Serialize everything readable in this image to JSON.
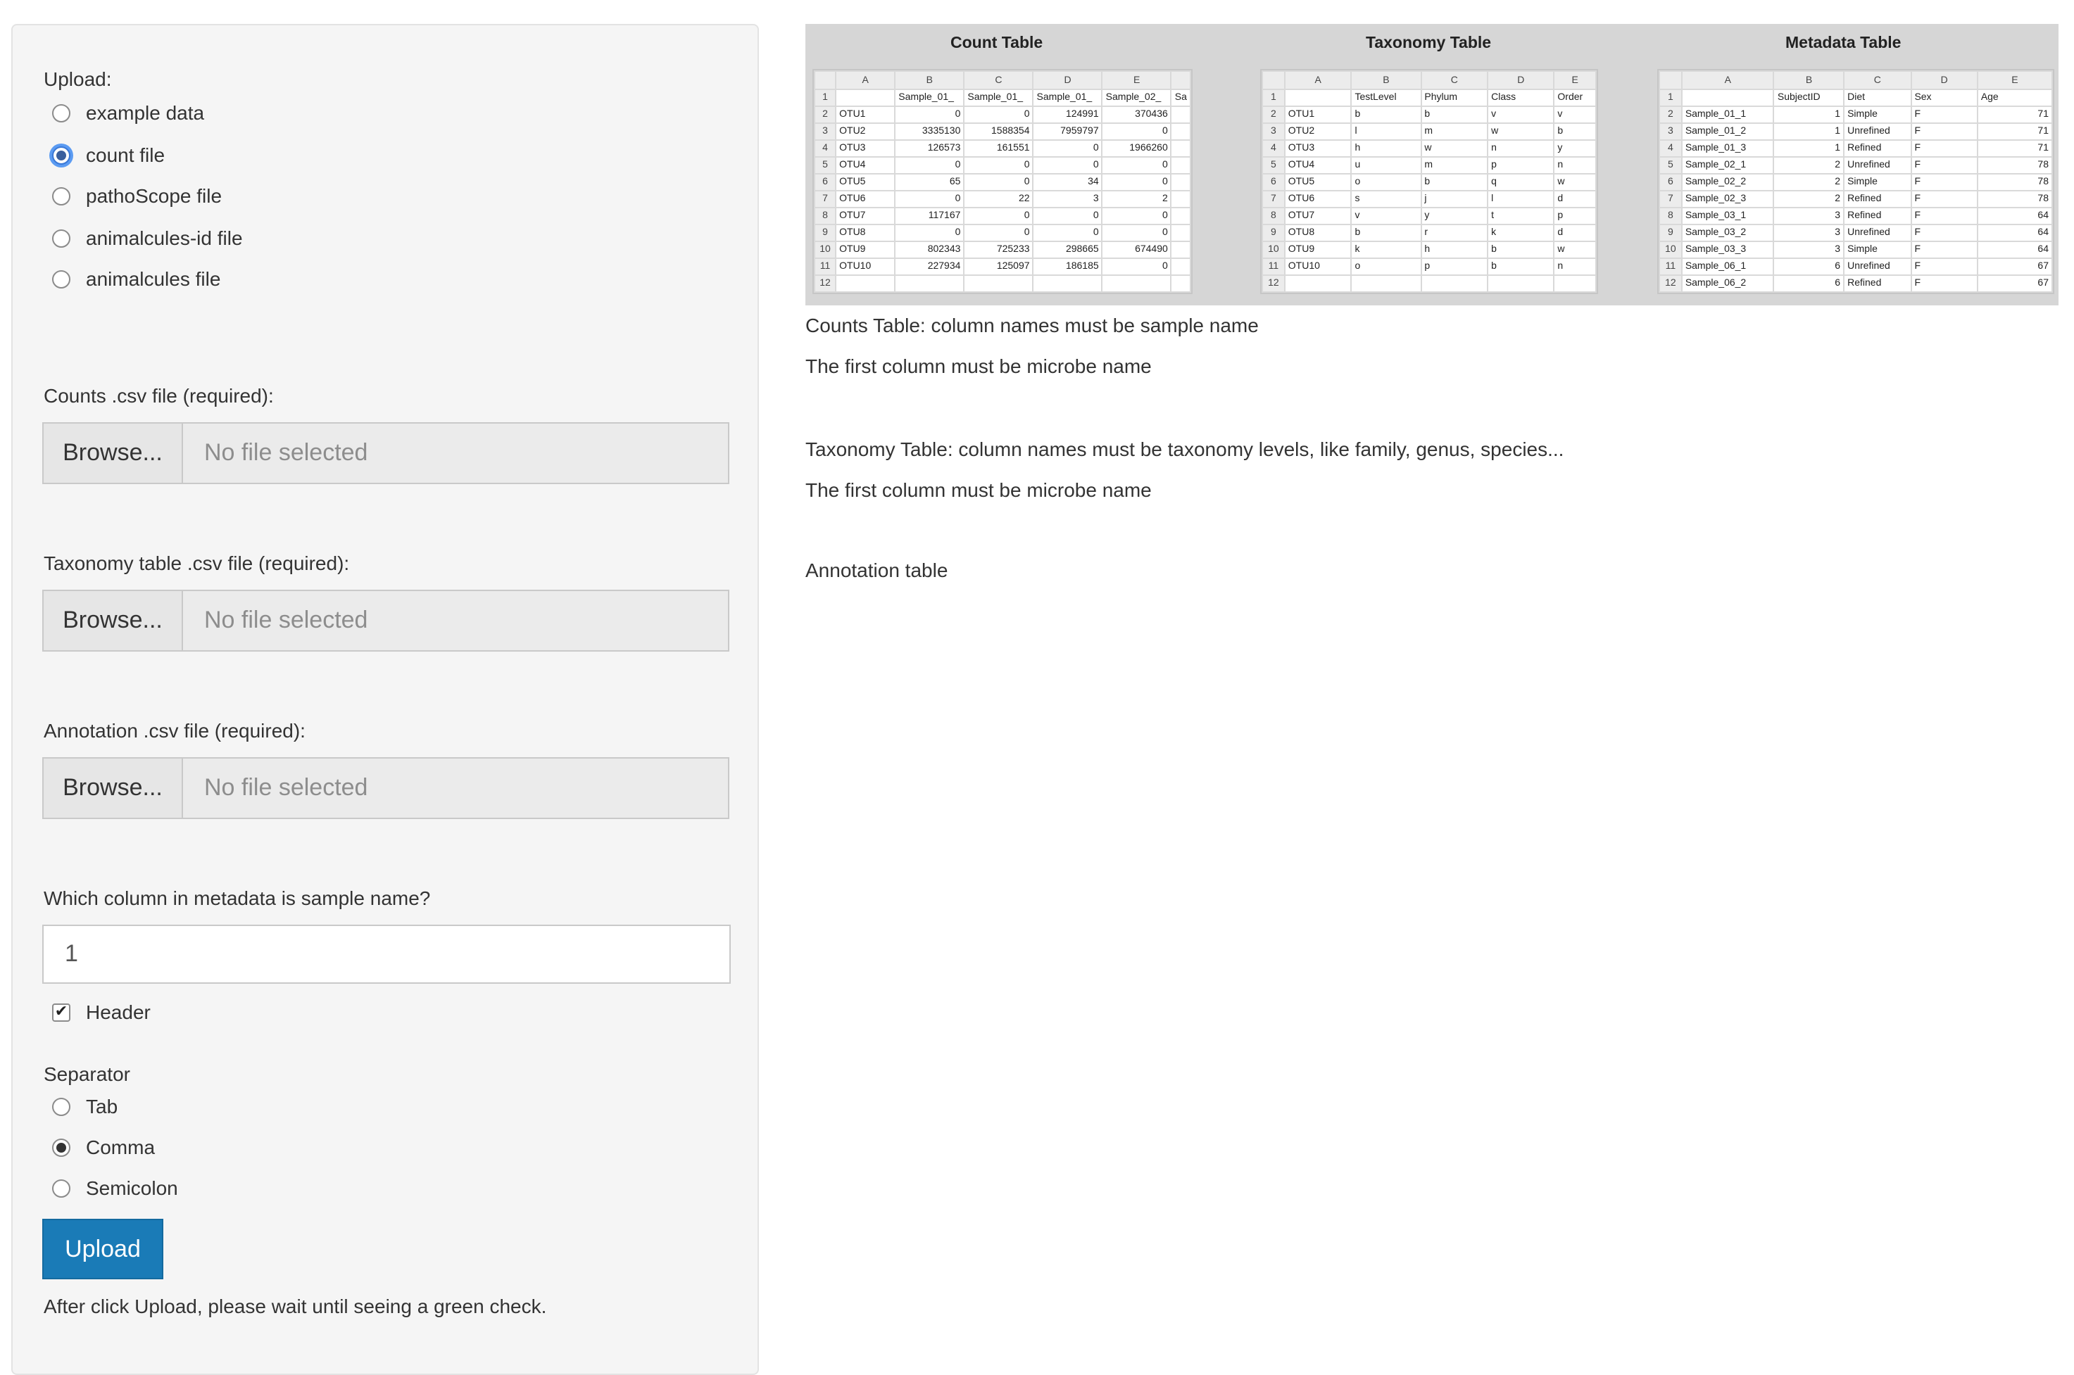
{
  "upload": {
    "label": "Upload:",
    "options": [
      "example data",
      "count file",
      "pathoScope file",
      "animalcules-id file",
      "animalcules file"
    ],
    "selected": "count file"
  },
  "counts_file": {
    "label": "Counts .csv file (required):",
    "browse_label": "Browse...",
    "placeholder": "No file selected"
  },
  "taxonomy_file": {
    "label": "Taxonomy table .csv file (required):",
    "browse_label": "Browse...",
    "placeholder": "No file selected"
  },
  "annotation_file": {
    "label": "Annotation .csv file (required):",
    "browse_label": "Browse...",
    "placeholder": "No file selected"
  },
  "sample_column": {
    "label": "Which column in metadata is sample name?",
    "value": "1"
  },
  "header_checkbox": {
    "label": "Header",
    "checked": true
  },
  "separator": {
    "label": "Separator",
    "options": [
      "Tab",
      "Comma",
      "Semicolon"
    ],
    "selected": "Comma"
  },
  "upload_button": {
    "label": "Upload",
    "color": "#1a7bb7"
  },
  "upload_note": "After click Upload, please wait until seeing a green check.",
  "preview": {
    "count_table": {
      "title": "Count Table",
      "columns": [
        "A",
        "B",
        "C",
        "D",
        "E"
      ],
      "rows": [
        [
          "",
          "Sample_01_",
          "Sample_01_",
          "Sample_01_",
          "Sample_02_",
          "Sa"
        ],
        [
          "OTU1",
          "0",
          "0",
          "124991",
          "370436",
          ""
        ],
        [
          "OTU2",
          "3335130",
          "1588354",
          "7959797",
          "0",
          ""
        ],
        [
          "OTU3",
          "126573",
          "161551",
          "0",
          "1966260",
          ""
        ],
        [
          "OTU4",
          "0",
          "0",
          "0",
          "0",
          ""
        ],
        [
          "OTU5",
          "65",
          "0",
          "34",
          "0",
          ""
        ],
        [
          "OTU6",
          "0",
          "22",
          "3",
          "2",
          ""
        ],
        [
          "OTU7",
          "117167",
          "0",
          "0",
          "0",
          ""
        ],
        [
          "OTU8",
          "0",
          "0",
          "0",
          "0",
          ""
        ],
        [
          "OTU9",
          "802343",
          "725233",
          "298665",
          "674490",
          ""
        ],
        [
          "OTU10",
          "227934",
          "125097",
          "186185",
          "0",
          ""
        ],
        [
          "",
          "",
          "",
          "",
          "",
          ""
        ]
      ]
    },
    "taxonomy_table": {
      "title": "Taxonomy Table",
      "columns": [
        "A",
        "B",
        "C",
        "D",
        "E"
      ],
      "rows": [
        [
          "",
          "TestLevel",
          "Phylum",
          "Class",
          "Order"
        ],
        [
          "OTU1",
          "b",
          "b",
          "v",
          "v"
        ],
        [
          "OTU2",
          "l",
          "m",
          "w",
          "b"
        ],
        [
          "OTU3",
          "h",
          "w",
          "n",
          "y"
        ],
        [
          "OTU4",
          "u",
          "m",
          "p",
          "n"
        ],
        [
          "OTU5",
          "o",
          "b",
          "q",
          "w"
        ],
        [
          "OTU6",
          "s",
          "j",
          "l",
          "d"
        ],
        [
          "OTU7",
          "v",
          "y",
          "t",
          "p"
        ],
        [
          "OTU8",
          "b",
          "r",
          "k",
          "d"
        ],
        [
          "OTU9",
          "k",
          "h",
          "b",
          "w"
        ],
        [
          "OTU10",
          "o",
          "p",
          "b",
          "n"
        ],
        [
          "",
          "",
          "",
          "",
          ""
        ]
      ]
    },
    "metadata_table": {
      "title": "Metadata Table",
      "columns": [
        "A",
        "B",
        "C",
        "D",
        "E"
      ],
      "rows": [
        [
          "",
          "SubjectID",
          "Diet",
          "Sex",
          "Age"
        ],
        [
          "Sample_01_1",
          "1",
          "Simple",
          "F",
          "71"
        ],
        [
          "Sample_01_2",
          "1",
          "Unrefined",
          "F",
          "71"
        ],
        [
          "Sample_01_3",
          "1",
          "Refined",
          "F",
          "71"
        ],
        [
          "Sample_02_1",
          "2",
          "Unrefined",
          "F",
          "78"
        ],
        [
          "Sample_02_2",
          "2",
          "Simple",
          "F",
          "78"
        ],
        [
          "Sample_02_3",
          "2",
          "Refined",
          "F",
          "78"
        ],
        [
          "Sample_03_1",
          "3",
          "Refined",
          "F",
          "64"
        ],
        [
          "Sample_03_2",
          "3",
          "Unrefined",
          "F",
          "64"
        ],
        [
          "Sample_03_3",
          "3",
          "Simple",
          "F",
          "64"
        ],
        [
          "Sample_06_1",
          "6",
          "Unrefined",
          "F",
          "67"
        ],
        [
          "Sample_06_2",
          "6",
          "Refined",
          "F",
          "67"
        ]
      ]
    }
  },
  "notes": {
    "counts_line1": "Counts Table: column names must be sample name",
    "counts_line2": "The first column must be microbe name",
    "taxonomy_line1": "Taxonomy Table: column names must be taxonomy levels, like family, genus, species...",
    "taxonomy_line2": "The first column must be microbe name",
    "annotation_line": "Annotation table"
  }
}
